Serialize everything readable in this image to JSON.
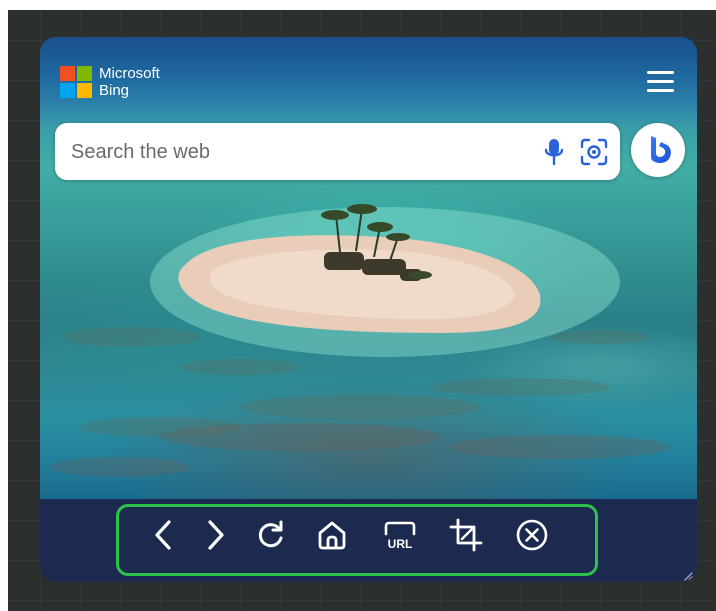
{
  "header": {
    "brand_line1": "Microsoft",
    "brand_line2": "Bing",
    "logo_colors": [
      "#f25022",
      "#7fba00",
      "#00a4ef",
      "#ffb900"
    ],
    "menu_icon": "hamburger-menu-icon"
  },
  "search": {
    "placeholder": "Search the web",
    "value": "",
    "mic_icon": "microphone-icon",
    "visual_search_icon": "visual-search-icon",
    "copilot_icon": "bing-copilot-icon"
  },
  "toolbar": {
    "highlight_color": "#2ec24a",
    "background_color": "#1b2a4e",
    "buttons": [
      {
        "icon": "back-icon",
        "label": "Back"
      },
      {
        "icon": "forward-icon",
        "label": "Forward"
      },
      {
        "icon": "refresh-icon",
        "label": "Refresh"
      },
      {
        "icon": "home-icon",
        "label": "Home"
      },
      {
        "icon": "url-icon",
        "label": "URL"
      },
      {
        "icon": "crop-icon",
        "label": "Crop"
      },
      {
        "icon": "close-icon",
        "label": "Close"
      }
    ]
  },
  "background": {
    "image": "aerial view of a small sandy island with palm trees surrounded by turquoise reef water"
  }
}
